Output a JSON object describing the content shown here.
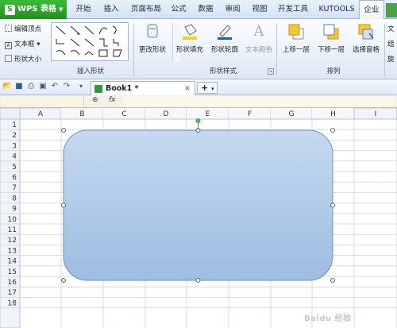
{
  "app": {
    "name": "WPS 表格",
    "logo_glyph": "S"
  },
  "menu": {
    "items": [
      "开始",
      "插入",
      "页面布局",
      "公式",
      "数据",
      "审阅",
      "视图",
      "开发工具",
      "KUTOOLS",
      "企业"
    ],
    "active_index": 9
  },
  "ribbon": {
    "left_small": [
      "编辑顶点",
      "文本框",
      "形状大小"
    ],
    "groups": {
      "insert_shape": "插入形状",
      "shape_style": "形状样式",
      "arrange": "排列"
    },
    "buttons": {
      "change_shape": "更改形状",
      "shape_fill": "形状填充",
      "shape_outline": "形状轮廓",
      "text_color": "文本颜色",
      "bring_forward": "上移一层",
      "send_backward": "下移一层",
      "selection_pane": "选择窗格"
    },
    "right_edge_labels": [
      "文",
      "组",
      "旋"
    ]
  },
  "tabbar": {
    "document_title": "Book1 *",
    "close_glyph": "×",
    "new_tab_glyph": "+"
  },
  "formula_bar": {
    "fx_label": "fx",
    "name_box": "",
    "formula": ""
  },
  "grid": {
    "columns": [
      "A",
      "B",
      "C",
      "D",
      "E",
      "F",
      "G",
      "H",
      "I"
    ],
    "rows": [
      "1",
      "2",
      "3",
      "4",
      "5",
      "6",
      "7",
      "8",
      "9",
      "10",
      "11",
      "12",
      "13",
      "14",
      "15",
      "16",
      "17",
      "18"
    ]
  },
  "shape": {
    "type": "rounded-rectangle",
    "fill_top": "#c5d9ef",
    "fill_bottom": "#9dbde2",
    "stroke": "#6d93c1",
    "selected": true
  },
  "colors": {
    "app_green": "#2b9d28",
    "ribbon_blue": "#dde8f6"
  },
  "watermark": "Baidu 经验"
}
